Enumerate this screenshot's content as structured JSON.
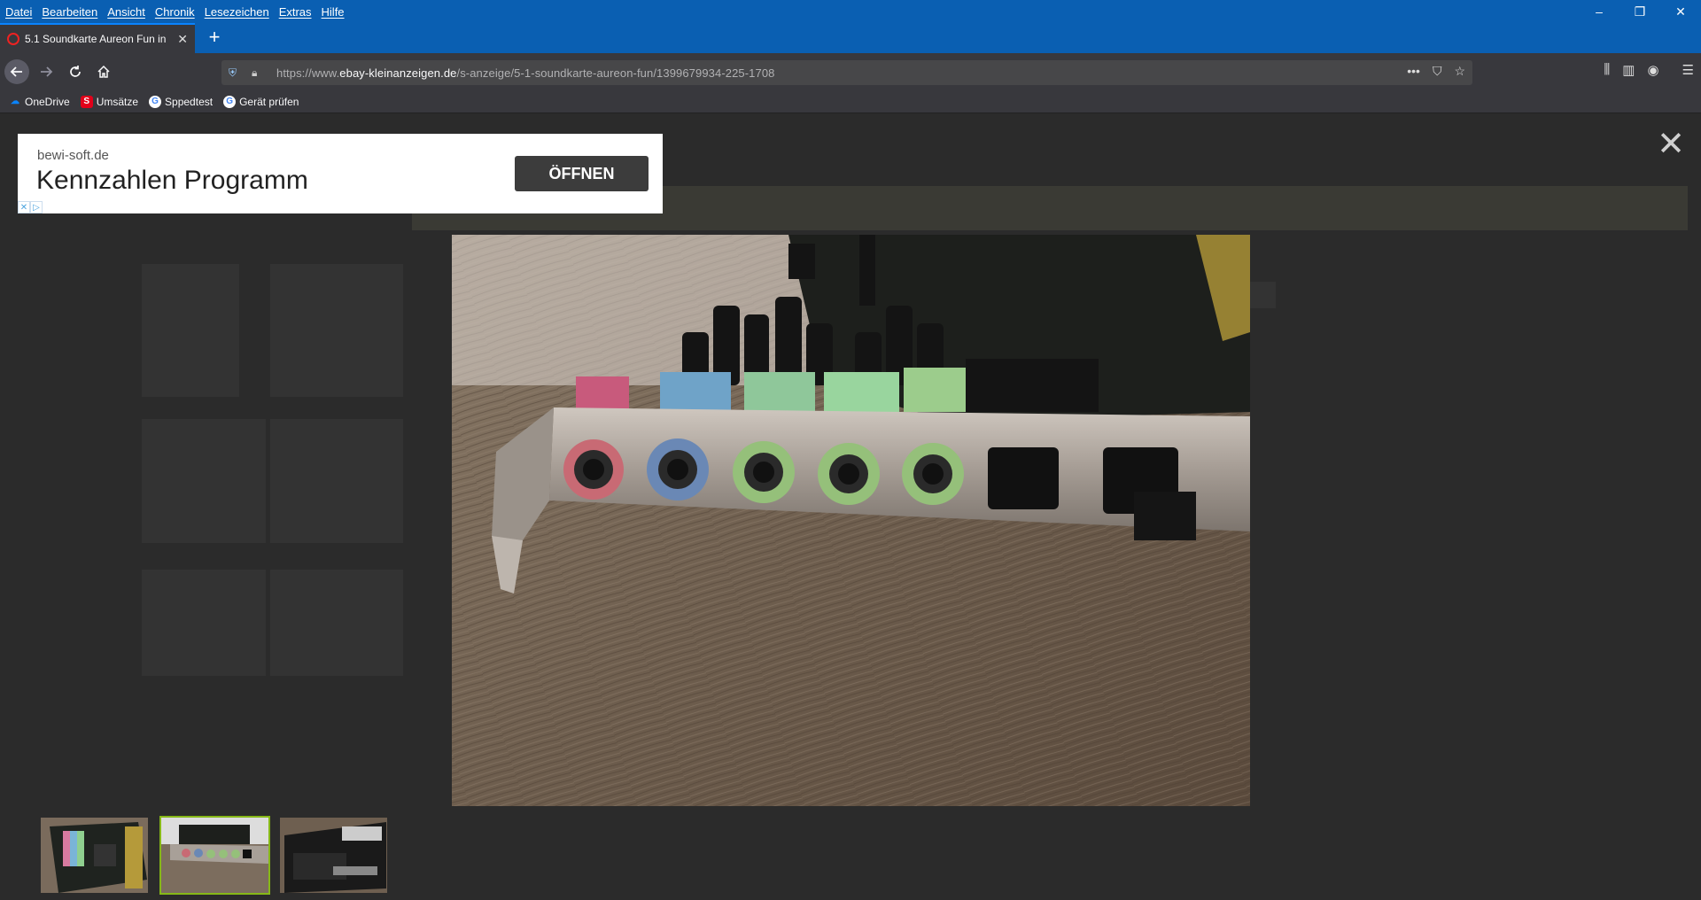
{
  "menubar": {
    "items": [
      "Datei",
      "Bearbeiten",
      "Ansicht",
      "Chronik",
      "Lesezeichen",
      "Extras",
      "Hilfe"
    ]
  },
  "window_controls": {
    "minimize": "–",
    "restore": "❐",
    "close": "✕"
  },
  "tab": {
    "title": "5.1 Soundkarte Aureon Fun in ",
    "close": "✕"
  },
  "newtab": "+",
  "nav": {
    "url_prefix": "https://www.",
    "url_domain": "ebay-kleinanzeigen.de",
    "url_path": "/s-anzeige/5-1-soundkarte-aureon-fun/1399679934-225-1708"
  },
  "bookmarks": [
    {
      "label": "OneDrive",
      "icon": "onedrive-icon",
      "color": "#0a84ff"
    },
    {
      "label": "Umsätze",
      "icon": "sparkasse-icon",
      "color": "#e2001a"
    },
    {
      "label": "Sppedtest",
      "icon": "google-icon",
      "color": "#ffffff"
    },
    {
      "label": "Gerät prüfen",
      "icon": "google-icon",
      "color": "#ffffff"
    }
  ],
  "ad": {
    "domain": "bewi-soft.de",
    "headline": "Kennzahlen Programm",
    "button": "ÖFFNEN"
  },
  "lightbox": {
    "close": "✕",
    "thumbnails": [
      {
        "alt": "Soundkarte Vorderseite",
        "active": false
      },
      {
        "alt": "Soundkarte Anschlüsse",
        "active": true
      },
      {
        "alt": "Soundkarte Verpackung",
        "active": false
      }
    ]
  },
  "colors": {
    "titlebar": "#0a5fb2",
    "toolbar": "#38383d",
    "active_thumb_border": "#86b817"
  }
}
